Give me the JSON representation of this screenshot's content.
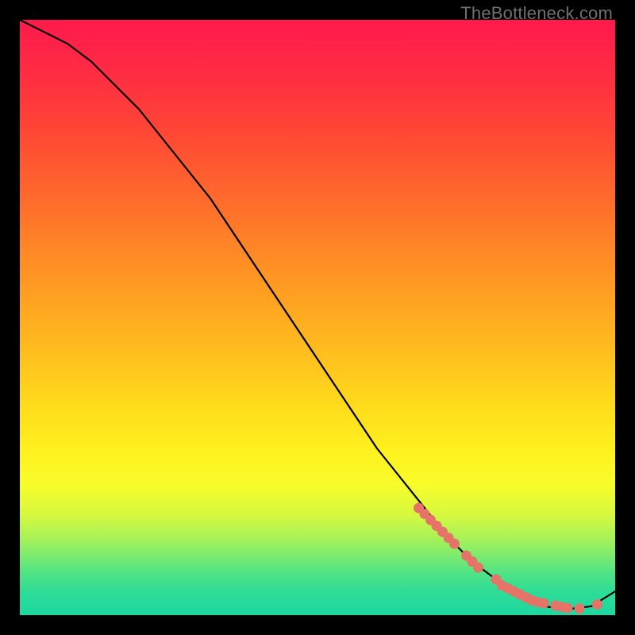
{
  "watermark": "TheBottleneck.com",
  "chart_data": {
    "type": "line",
    "title": "",
    "xlabel": "",
    "ylabel": "",
    "xlim": [
      0,
      100
    ],
    "ylim": [
      0,
      100
    ],
    "curve": {
      "x": [
        0,
        4,
        8,
        12,
        16,
        20,
        24,
        28,
        32,
        36,
        40,
        44,
        48,
        52,
        56,
        60,
        64,
        68,
        72,
        76,
        80,
        84,
        88,
        92,
        96,
        100
      ],
      "y": [
        100,
        98,
        96,
        93,
        89,
        85,
        80,
        75,
        70,
        64,
        58,
        52,
        46,
        40,
        34,
        28,
        23,
        18,
        13,
        9,
        6,
        3,
        1.5,
        1.0,
        1.5,
        4
      ]
    },
    "dots": {
      "x": [
        67,
        68,
        69,
        70,
        71,
        72,
        73,
        75,
        76,
        77,
        80,
        81,
        82,
        83,
        84,
        85,
        86,
        87,
        88,
        90,
        91,
        92,
        94,
        97
      ],
      "y": [
        18,
        17,
        16,
        15,
        14,
        13,
        12,
        10,
        9,
        8,
        6,
        5,
        4.5,
        4,
        3.5,
        3,
        2.5,
        2.2,
        2,
        1.6,
        1.4,
        1.2,
        1.1,
        1.8
      ]
    },
    "colors": {
      "line": "#000000",
      "dots": "#e57368"
    }
  }
}
